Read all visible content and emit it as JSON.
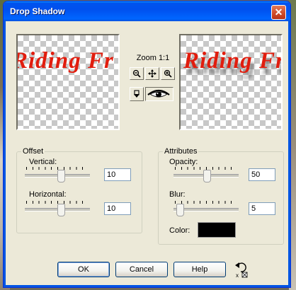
{
  "window": {
    "title": "Drop Shadow",
    "close_glyph": "✕"
  },
  "preview": {
    "text": "Riding Fr"
  },
  "zoom": {
    "label": "Zoom 1:1"
  },
  "toolbar": {
    "zoom_out_icon": "zoom-out-icon",
    "pan_icon": "pan-icon",
    "zoom_in_icon": "zoom-in-icon",
    "locate_icon": "locate-icon",
    "eye_icon": "eye-icon"
  },
  "offset": {
    "group_label": "Offset",
    "vertical_label": "Vertical:",
    "vertical_value": "10",
    "horizontal_label": "Horizontal:",
    "horizontal_value": "10"
  },
  "attributes": {
    "group_label": "Attributes",
    "opacity_label": "Opacity:",
    "opacity_value": "50",
    "blur_label": "Blur:",
    "blur_value": "5",
    "color_label": "Color:",
    "color_value": "#000000"
  },
  "buttons": {
    "ok": "OK",
    "cancel": "Cancel",
    "help": "Help"
  },
  "colors": {
    "title_bar": "#0054e3",
    "dialog_bg": "#ece9d8",
    "preview_text": "#e11d0e"
  }
}
